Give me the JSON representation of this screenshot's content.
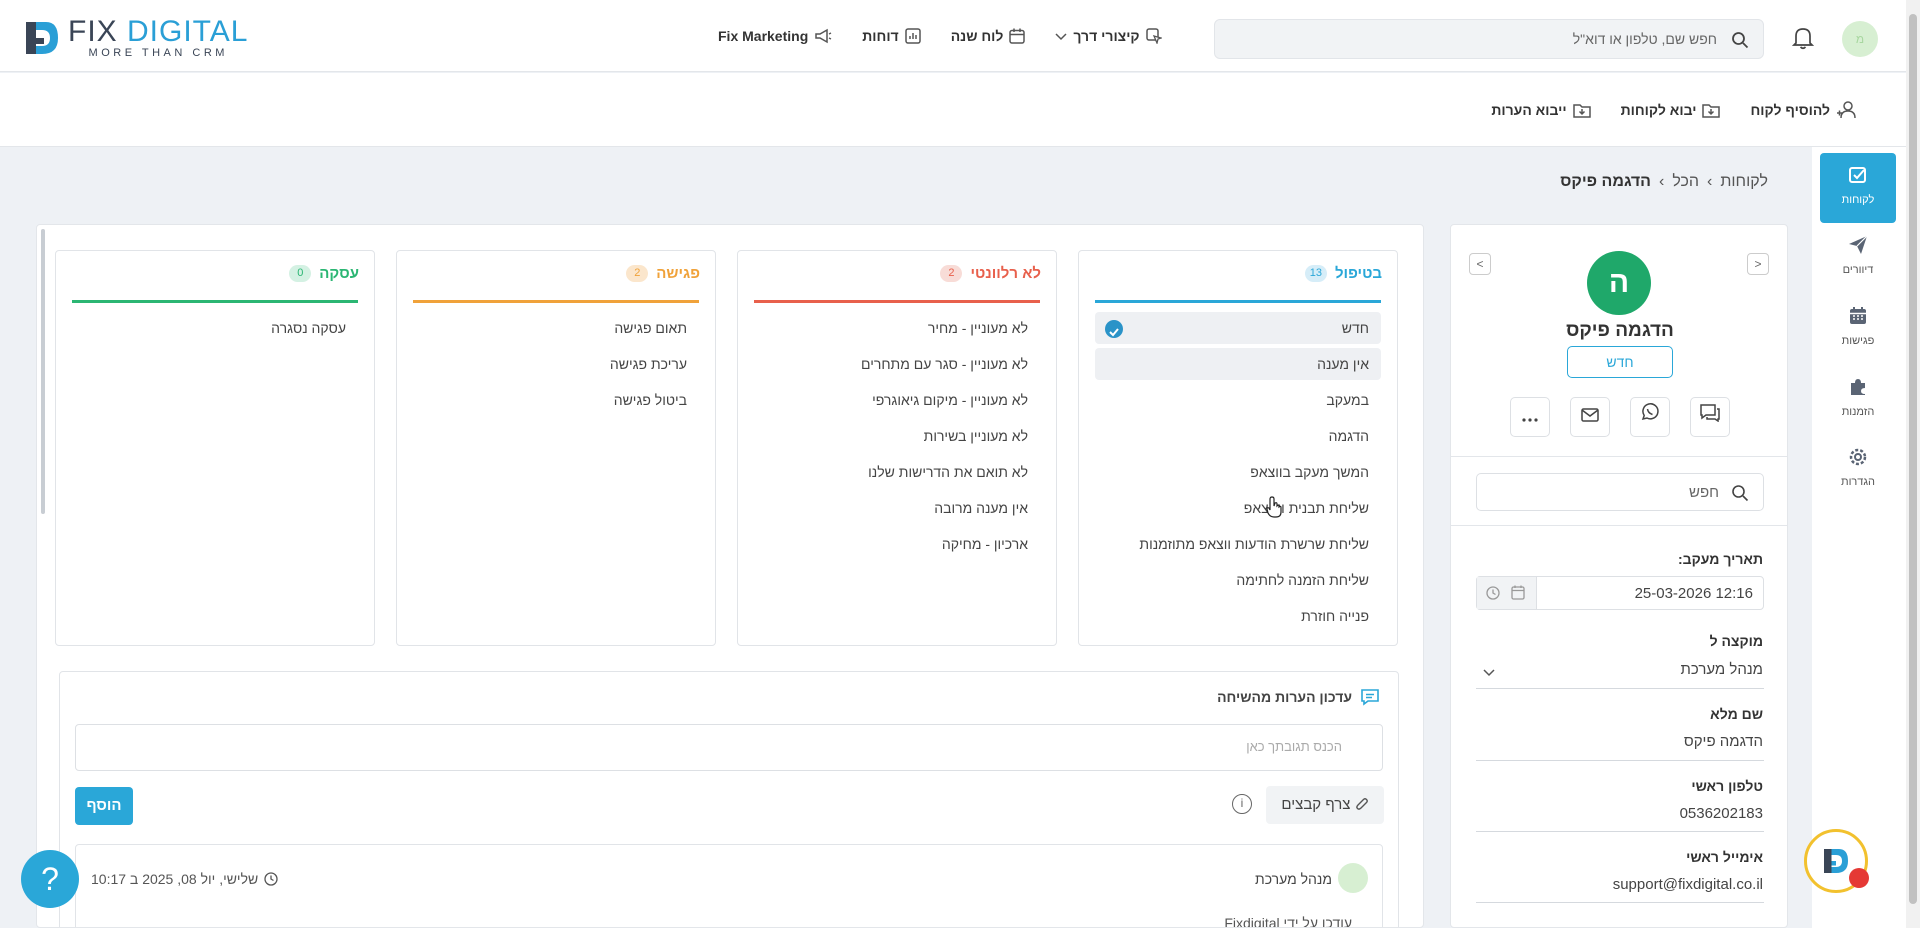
{
  "header": {
    "logo": {
      "main_left": "FIX",
      "main_right": "DIGITAL",
      "tagline": "MORE THAN CRM"
    },
    "nav": [
      {
        "label": "Fix Marketing",
        "icon": "megaphone-icon"
      },
      {
        "label": "דוחות",
        "icon": "chart-icon"
      },
      {
        "label": "לוח שנה",
        "icon": "calendar-icon"
      },
      {
        "label": "קיצורי דרך",
        "icon": "shortcut-icon"
      }
    ],
    "search_placeholder": "חפש שם, טלפון או דוא\"ל",
    "user_initials": "מ"
  },
  "subbar": {
    "actions": [
      {
        "label": "להוסיף לקוח",
        "icon": "add-user-icon"
      },
      {
        "label": "יבוא לקוחות",
        "icon": "import-icon"
      },
      {
        "label": "ייבוא הערות",
        "icon": "import-notes-icon"
      }
    ]
  },
  "sidebar": {
    "items": [
      {
        "label": "לקוחות",
        "icon": "checkbox-icon",
        "active": true
      },
      {
        "label": "דיוורים",
        "icon": "send-icon"
      },
      {
        "label": "פגישות",
        "icon": "calendar-icon"
      },
      {
        "label": "הזמנות",
        "icon": "puzzle-icon"
      },
      {
        "label": "הגדרות",
        "icon": "gear-icon"
      }
    ]
  },
  "breadcrumb": {
    "items": [
      "לקוחות",
      "הכל",
      "הדגמה פיקס"
    ]
  },
  "contact": {
    "initial": "ה",
    "name": "הדגמה פיקס",
    "status": "חדש",
    "search_placeholder": "חפש",
    "fields": {
      "followup_label": "תאריך מעקב:",
      "followup_value": "25-03-2026 12:16",
      "assigned_label": "מוקצה ל",
      "assigned_value": "מנהל מערכת",
      "fullname_label": "שם מלא",
      "fullname_value": "הדגמה פיקס",
      "phone_label": "טלפון ראשי",
      "phone_value": "0536202183",
      "email_label": "אימייל ראשי",
      "email_value": "support@fixdigital.co.il"
    }
  },
  "pipeline": [
    {
      "title": "בטיפול",
      "count": "13",
      "color": "#2aa7d8",
      "badge_bg": "#d6edf8",
      "items": [
        "חדש",
        "אין מענה",
        "במעקב",
        "הדגמה",
        "המשך מעקב בווצאפ",
        "שליחת תבנית וואצאפ",
        "שליחת שרשרת הודעות ווצאפ מתוזמנות",
        "שליחת הזמנה לחתימה",
        "פנייה חוזרת"
      ]
    },
    {
      "title": "לא רלוונטי",
      "count": "2",
      "color": "#e8604c",
      "badge_bg": "#f8dcd7",
      "items": [
        "לא מעוניין - מחיר",
        "לא מעוניין - סגר עם מתחרים",
        "לא מעוניין - מיקום גיאוגרפי",
        "לא מעוניין בשירות",
        "לא תואם את הדרישות שלנו",
        "אין מענה מרובה",
        "ארכיון - מחיקה"
      ]
    },
    {
      "title": "פגישה",
      "count": "2",
      "color": "#f0a23a",
      "badge_bg": "#fbe6cc",
      "items": [
        "תאום פגישה",
        "עריכת פגישה",
        "ביטול פגישה"
      ]
    },
    {
      "title": "עסקה",
      "count": "0",
      "color": "#2bb673",
      "badge_bg": "#d4f1e3",
      "items": [
        "עסקה נסגרה"
      ]
    }
  ],
  "notes": {
    "title": "עדכון הערות מהשיחה",
    "placeholder": "הכנס תגובתך כאן",
    "add_label": "הוסף",
    "attach_label": "צרף קבצים",
    "entry": {
      "user": "מנהל מערכת",
      "time": "שלישי, יול 08, 2025 ב 10:17",
      "by": "עודכן על ידי Fixdigital"
    }
  },
  "help_label": "?"
}
